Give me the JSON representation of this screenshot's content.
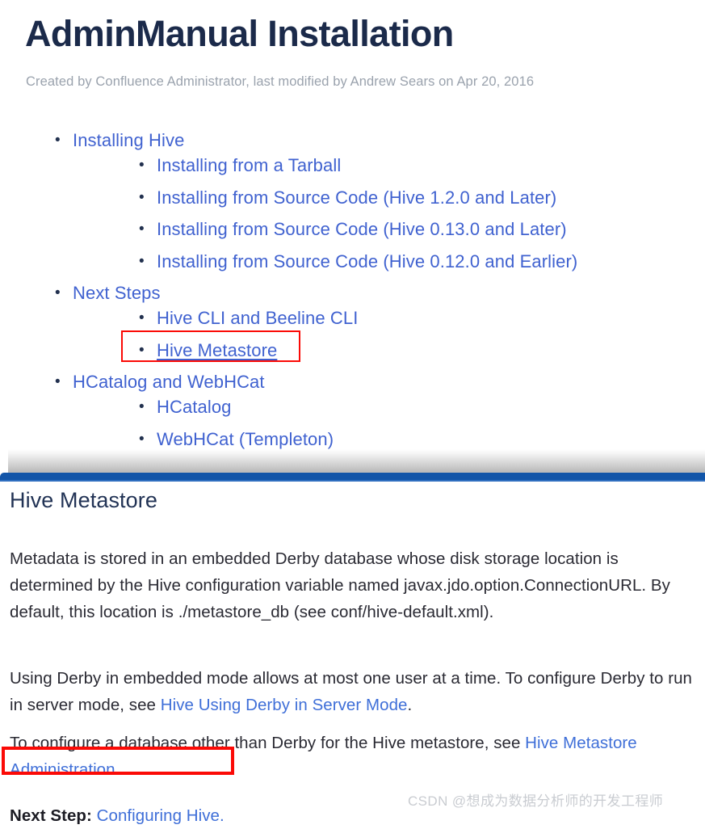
{
  "toc_panel": {
    "title": "AdminManual Installation",
    "byline": "Created by Confluence Administrator, last modified by Andrew Sears on Apr 20, 2016",
    "items": [
      {
        "label": "Installing Hive",
        "children": [
          {
            "label": "Installing from a Tarball"
          },
          {
            "label": "Installing from Source Code (Hive 1.2.0 and Later)"
          },
          {
            "label": "Installing from Source Code (Hive 0.13.0 and Later)"
          },
          {
            "label": "Installing from Source Code (Hive 0.12.0 and Earlier)"
          }
        ]
      },
      {
        "label": "Next Steps",
        "children": [
          {
            "label": "Hive CLI and Beeline CLI"
          },
          {
            "label": "Hive Metastore",
            "hovered": true,
            "annotated": true
          }
        ]
      },
      {
        "label": "HCatalog and WebHCat",
        "children": [
          {
            "label": "HCatalog"
          },
          {
            "label": "WebHCat (Templeton)"
          }
        ]
      }
    ]
  },
  "body_panel": {
    "heading": "Hive Metastore",
    "paragraph_1": "Metadata is stored in an embedded Derby database whose disk storage location is determined by the Hive configuration variable named javax.jdo.option.ConnectionURL. By default, this location is ./metastore_db (see conf/hive-default.xml).",
    "paragraph_2_before": "Using Derby in embedded mode allows at most one user at a time. To configure Derby to run in server mode, see ",
    "paragraph_2_link": "Hive Using Derby in Server Mode",
    "paragraph_2_after": ".",
    "paragraph_3_before": "To configure a database other than Derby for the Hive metastore, see ",
    "paragraph_3_link": "Hive Metastore Administration",
    "paragraph_3_after": ".",
    "next_step_label": "Next Step:",
    "next_step_link": "Configuring Hive.",
    "watermark": "CSDN @想成为数据分析师的开发工程师"
  },
  "colors": {
    "title": "#1b2a4a",
    "link": "#4062d0",
    "annotation_red": "#fb0a06",
    "accent_bar": "#1255a8",
    "byline": "#9aa2ad"
  }
}
